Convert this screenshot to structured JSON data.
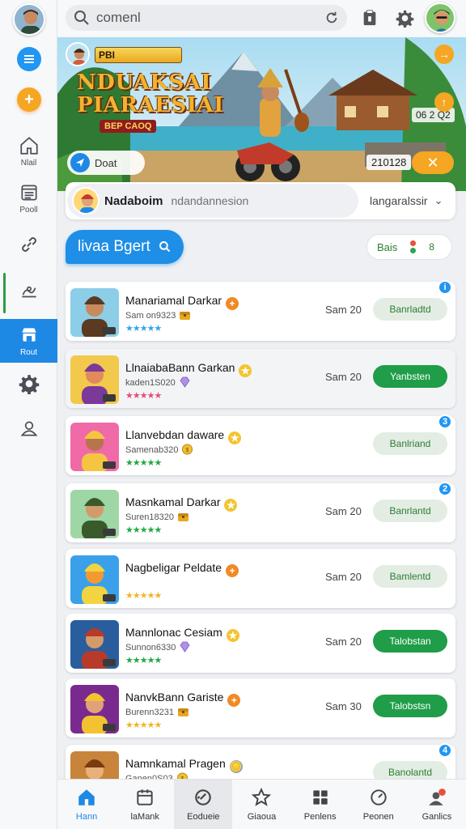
{
  "sidebar": {
    "items": [
      {
        "label": "Nlail",
        "icon": "home-icon"
      },
      {
        "label": "Pooll",
        "icon": "document-icon"
      },
      {
        "label": "",
        "icon": "link-icon"
      },
      {
        "label": "",
        "icon": "chart-icon"
      },
      {
        "label": "Rout",
        "icon": "storefront-icon"
      },
      {
        "label": "",
        "icon": "gear-icon"
      },
      {
        "label": "",
        "icon": "user-icon"
      }
    ]
  },
  "search": {
    "value": "comenl"
  },
  "banner": {
    "tag": "PBI",
    "title_line1": "NDUAKSAI",
    "title_line2": "PIARAESIAI",
    "subtitle": "BEP CAOQ",
    "count": "06 2 Q2",
    "pill_label": "Doat",
    "code": "210128"
  },
  "profile": {
    "name": "Nadaboim",
    "description": "ndandannesion",
    "language": "langaralssir"
  },
  "filter": {
    "label": "livaa Bgert",
    "toggle_label": "Bais"
  },
  "apps": [
    {
      "title": "Manariamal Darkar",
      "subtitle": "Sam on9323",
      "score": "Sam 20",
      "button": "Banrladtd",
      "style": "light",
      "badge": "+",
      "badge_color": "#f08a24",
      "sub_icon": "chest",
      "stars_color": "#35a5ea",
      "corner": "i"
    },
    {
      "title": "LlnaiabaBann Garkan",
      "subtitle": "kaden1S020",
      "score": "Sam 20",
      "button": "Yanbsten",
      "style": "dark",
      "badge": "★",
      "badge_color": "#f4c430",
      "sub_icon": "gem",
      "stars_color": "#e84c7a",
      "corner": ""
    },
    {
      "title": "Llanvebdan daware",
      "subtitle": "Samenab320",
      "score": "",
      "button": "Banlriand",
      "style": "light",
      "badge": "★",
      "badge_color": "#f4c430",
      "sub_icon": "coin",
      "stars_color": "#23a845",
      "corner": "3"
    },
    {
      "title": "Masnkamal Darkar",
      "subtitle": "Suren18320",
      "score": "Sam 20",
      "button": "Banrlantd",
      "style": "light",
      "badge": "★",
      "badge_color": "#f4c430",
      "sub_icon": "chest",
      "stars_color": "#23a845",
      "corner": "2"
    },
    {
      "title": "Nagbeligar Peldate",
      "subtitle": "",
      "score": "Sam 20",
      "button": "Bamlentd",
      "style": "light",
      "badge": "+",
      "badge_color": "#f08a24",
      "sub_icon": "",
      "stars_color": "#f0b429",
      "corner": ""
    },
    {
      "title": "Mannlonac Cesiam",
      "subtitle": "Sunnon6330",
      "score": "Sam 20",
      "button": "Talobstan",
      "style": "dark",
      "badge": "★",
      "badge_color": "#f4c430",
      "sub_icon": "gem",
      "stars_color": "#23a845",
      "corner": ""
    },
    {
      "title": "NanvkBann Gariste",
      "subtitle": "Burenn3231",
      "score": "Sam 30",
      "button": "Talobstsn",
      "style": "dark",
      "badge": "+",
      "badge_color": "#f08a24",
      "sub_icon": "chest",
      "stars_color": "#f0b429",
      "corner": ""
    },
    {
      "title": "Namnkamal Pragen",
      "subtitle": "Ganen0S03",
      "score": "",
      "button": "Banolantd",
      "style": "light",
      "badge": "🪙",
      "badge_color": "#9aa3ad",
      "sub_icon": "coin",
      "stars_color": "",
      "corner": "4"
    }
  ],
  "bottom_nav": [
    {
      "label": "Hann",
      "icon": "home-icon"
    },
    {
      "label": "laMank",
      "icon": "calendar-icon"
    },
    {
      "label": "Eodueie",
      "icon": "link-icon"
    },
    {
      "label": "Giaoua",
      "icon": "star-icon"
    },
    {
      "label": "Penlens",
      "icon": "grid-icon"
    },
    {
      "label": "Peonen",
      "icon": "gauge-icon"
    },
    {
      "label": "Ganlics",
      "icon": "profile-notification-icon"
    }
  ],
  "colors": {
    "accent": "#1e88e5",
    "orange": "#f5a623",
    "green": "#1f9d48"
  }
}
